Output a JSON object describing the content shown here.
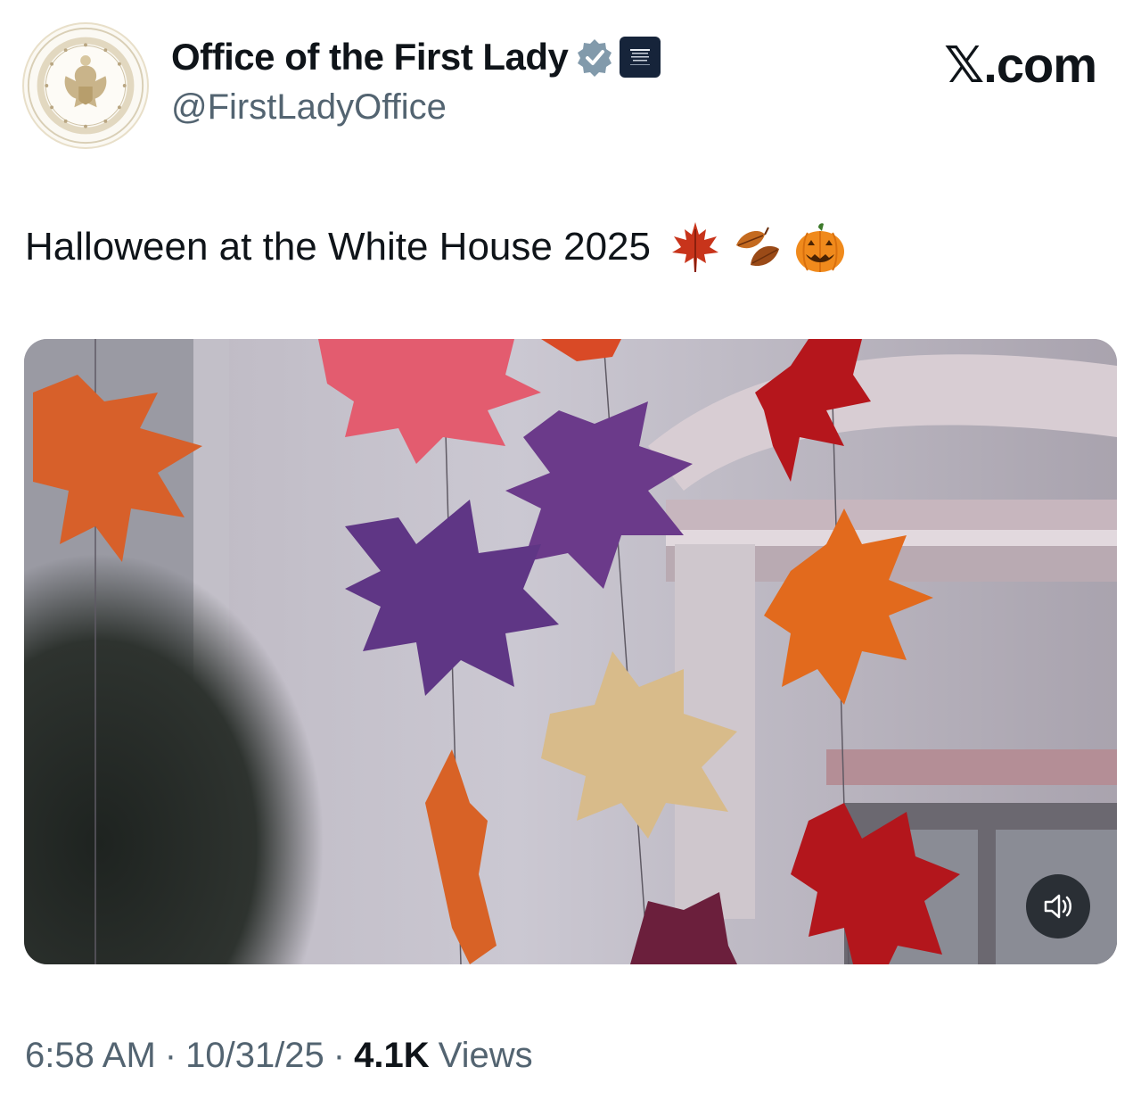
{
  "author": {
    "display_name": "Office of the First Lady",
    "handle": "@FirstLadyOffice",
    "verified_badge": "verified-badge-icon",
    "affiliation_badge": "white-house-badge-icon",
    "avatar": "first-lady-seal-avatar"
  },
  "source": {
    "label": "𝕏.com"
  },
  "tweet": {
    "text": "Halloween at the White House 2025",
    "emojis": [
      "maple-leaf-emoji",
      "fallen-leaf-emoji",
      "jack-o-lantern-emoji"
    ]
  },
  "media": {
    "type": "video",
    "description_icon": "autumn-leaves-garland-video",
    "sound_toggle": "speaker-icon"
  },
  "meta": {
    "time": "6:58 AM",
    "separator": "·",
    "date": "10/31/25",
    "views_count": "4.1K",
    "views_label": "Views"
  },
  "colors": {
    "text_primary": "#0f1419",
    "text_secondary": "#536471",
    "verified_blue": "#829aab",
    "background": "#ffffff"
  }
}
